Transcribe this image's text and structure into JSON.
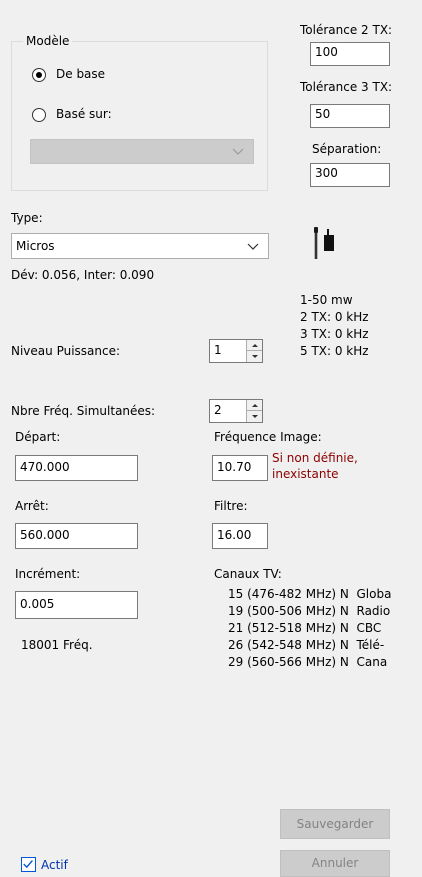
{
  "model_group": {
    "title": "Modèle",
    "radio_base_label": "De base",
    "radio_based_on_label": "Basé sur:",
    "based_on_value": ""
  },
  "tolerance": {
    "tx2_label": "Tolérance 2 TX:",
    "tx2_value": "100",
    "tx3_label": "Tolérance 3 TX:",
    "tx3_value": "50",
    "separation_label": "Séparation:",
    "separation_value": "300"
  },
  "type": {
    "label": "Type:",
    "selected": "Micros",
    "dev_inter": "Dév: 0.056, Inter: 0.090"
  },
  "device_icon": "microphone-and-bodypack-icon",
  "specs": [
    "1-50 mw",
    "2 TX: 0 kHz",
    "3 TX: 0 kHz",
    "5 TX: 0 kHz"
  ],
  "power": {
    "label": "Niveau Puissance:",
    "value": "1"
  },
  "simultaneous": {
    "label": "Nbre Fréq. Simultanées:",
    "value": "2"
  },
  "start": {
    "label": "Départ:",
    "value": "470.000"
  },
  "image_freq": {
    "label": "Fréquence Image:",
    "value": "10.70",
    "note_line1": "Si non définie,",
    "note_line2": "inexistante"
  },
  "stop": {
    "label": "Arrêt:",
    "value": "560.000"
  },
  "filter": {
    "label": "Filtre:",
    "value": "16.00"
  },
  "increment": {
    "label": "Incrément:",
    "value": "0.005",
    "count": "18001 Fréq."
  },
  "tv_channels": {
    "label": "Canaux TV:",
    "items": [
      "15 (476-482 MHz) N  Globa",
      "19 (500-506 MHz) N  Radio",
      "21 (512-518 MHz) N  CBC",
      "26 (542-548 MHz) N  Télé-",
      "29 (560-566 MHz) N  Cana"
    ]
  },
  "buttons": {
    "save": "Sauvegarder",
    "cancel": "Annuler"
  },
  "active": {
    "label": "Actif",
    "checked": true
  },
  "colors": {
    "note": "#8b0000",
    "check_border": "#0057d8",
    "disabled_bg": "#cccccc"
  }
}
